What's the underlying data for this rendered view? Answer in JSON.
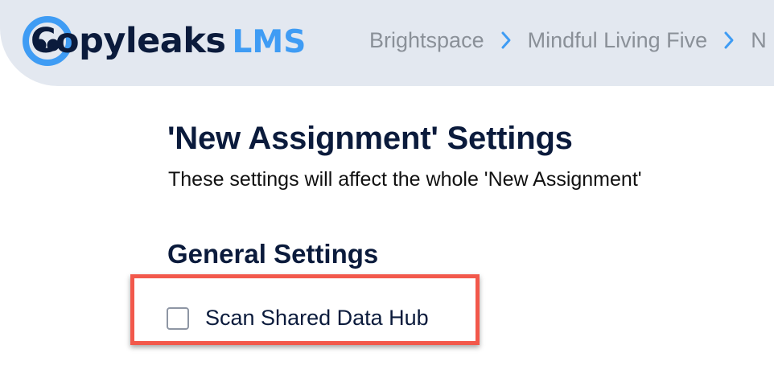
{
  "header": {
    "logo": {
      "brand": "Copyleaks",
      "product": "LMS"
    },
    "breadcrumb": {
      "items": [
        "Brightspace",
        "Mindful Living Five",
        "N"
      ],
      "separator_icon": "chevron-right-icon"
    }
  },
  "main": {
    "title": "'New Assignment' Settings",
    "subtitle": "These settings will affect the whole 'New Assignment'",
    "general_settings": {
      "heading": "General Settings",
      "options": [
        {
          "label": "Scan Shared Data Hub",
          "checked": false
        }
      ]
    }
  },
  "colors": {
    "header_bg": "#e3e8f0",
    "brand_dark": "#0b1b3c",
    "brand_blue": "#3f9cf4",
    "breadcrumb_text": "#8a9098",
    "highlight": "#f2584b"
  }
}
